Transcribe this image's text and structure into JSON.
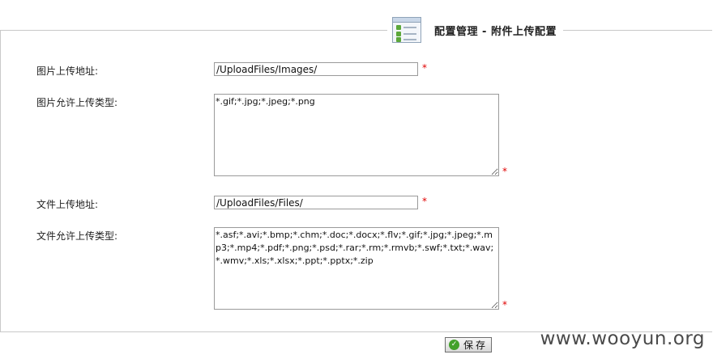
{
  "header": {
    "icon": "config-form-icon",
    "title": "配置管理 - 附件上传配置"
  },
  "form": {
    "image_upload_path": {
      "label": "图片上传地址:",
      "value": "/UploadFiles/Images/",
      "required_mark": "*"
    },
    "image_allowed_types": {
      "label": "图片允许上传类型:",
      "value": "*.gif;*.jpg;*.jpeg;*.png",
      "required_mark": "*"
    },
    "file_upload_path": {
      "label": "文件上传地址:",
      "value": "/UploadFiles/Files/",
      "required_mark": "*"
    },
    "file_allowed_types": {
      "label": "文件允许上传类型:",
      "value": "*.asf;*.avi;*.bmp;*.chm;*.doc;*.docx;*.flv;*.gif;*.jpg;*.jpeg;*.mp3;*.mp4;*.pdf;*.png;*.psd;*.rar;*.rm;*.rmvb;*.swf;*.txt;*.wav;*.wmv;*.xls;*.xlsx;*.ppt;*.pptx;*.zip",
      "required_mark": "*"
    }
  },
  "actions": {
    "save_label": "保存",
    "save_icon": "check-circle-icon"
  },
  "watermark": "www.wooyun.org",
  "colors": {
    "required": "#e00000",
    "save_icon": "#43a12b",
    "border": "#9a9a9a"
  }
}
